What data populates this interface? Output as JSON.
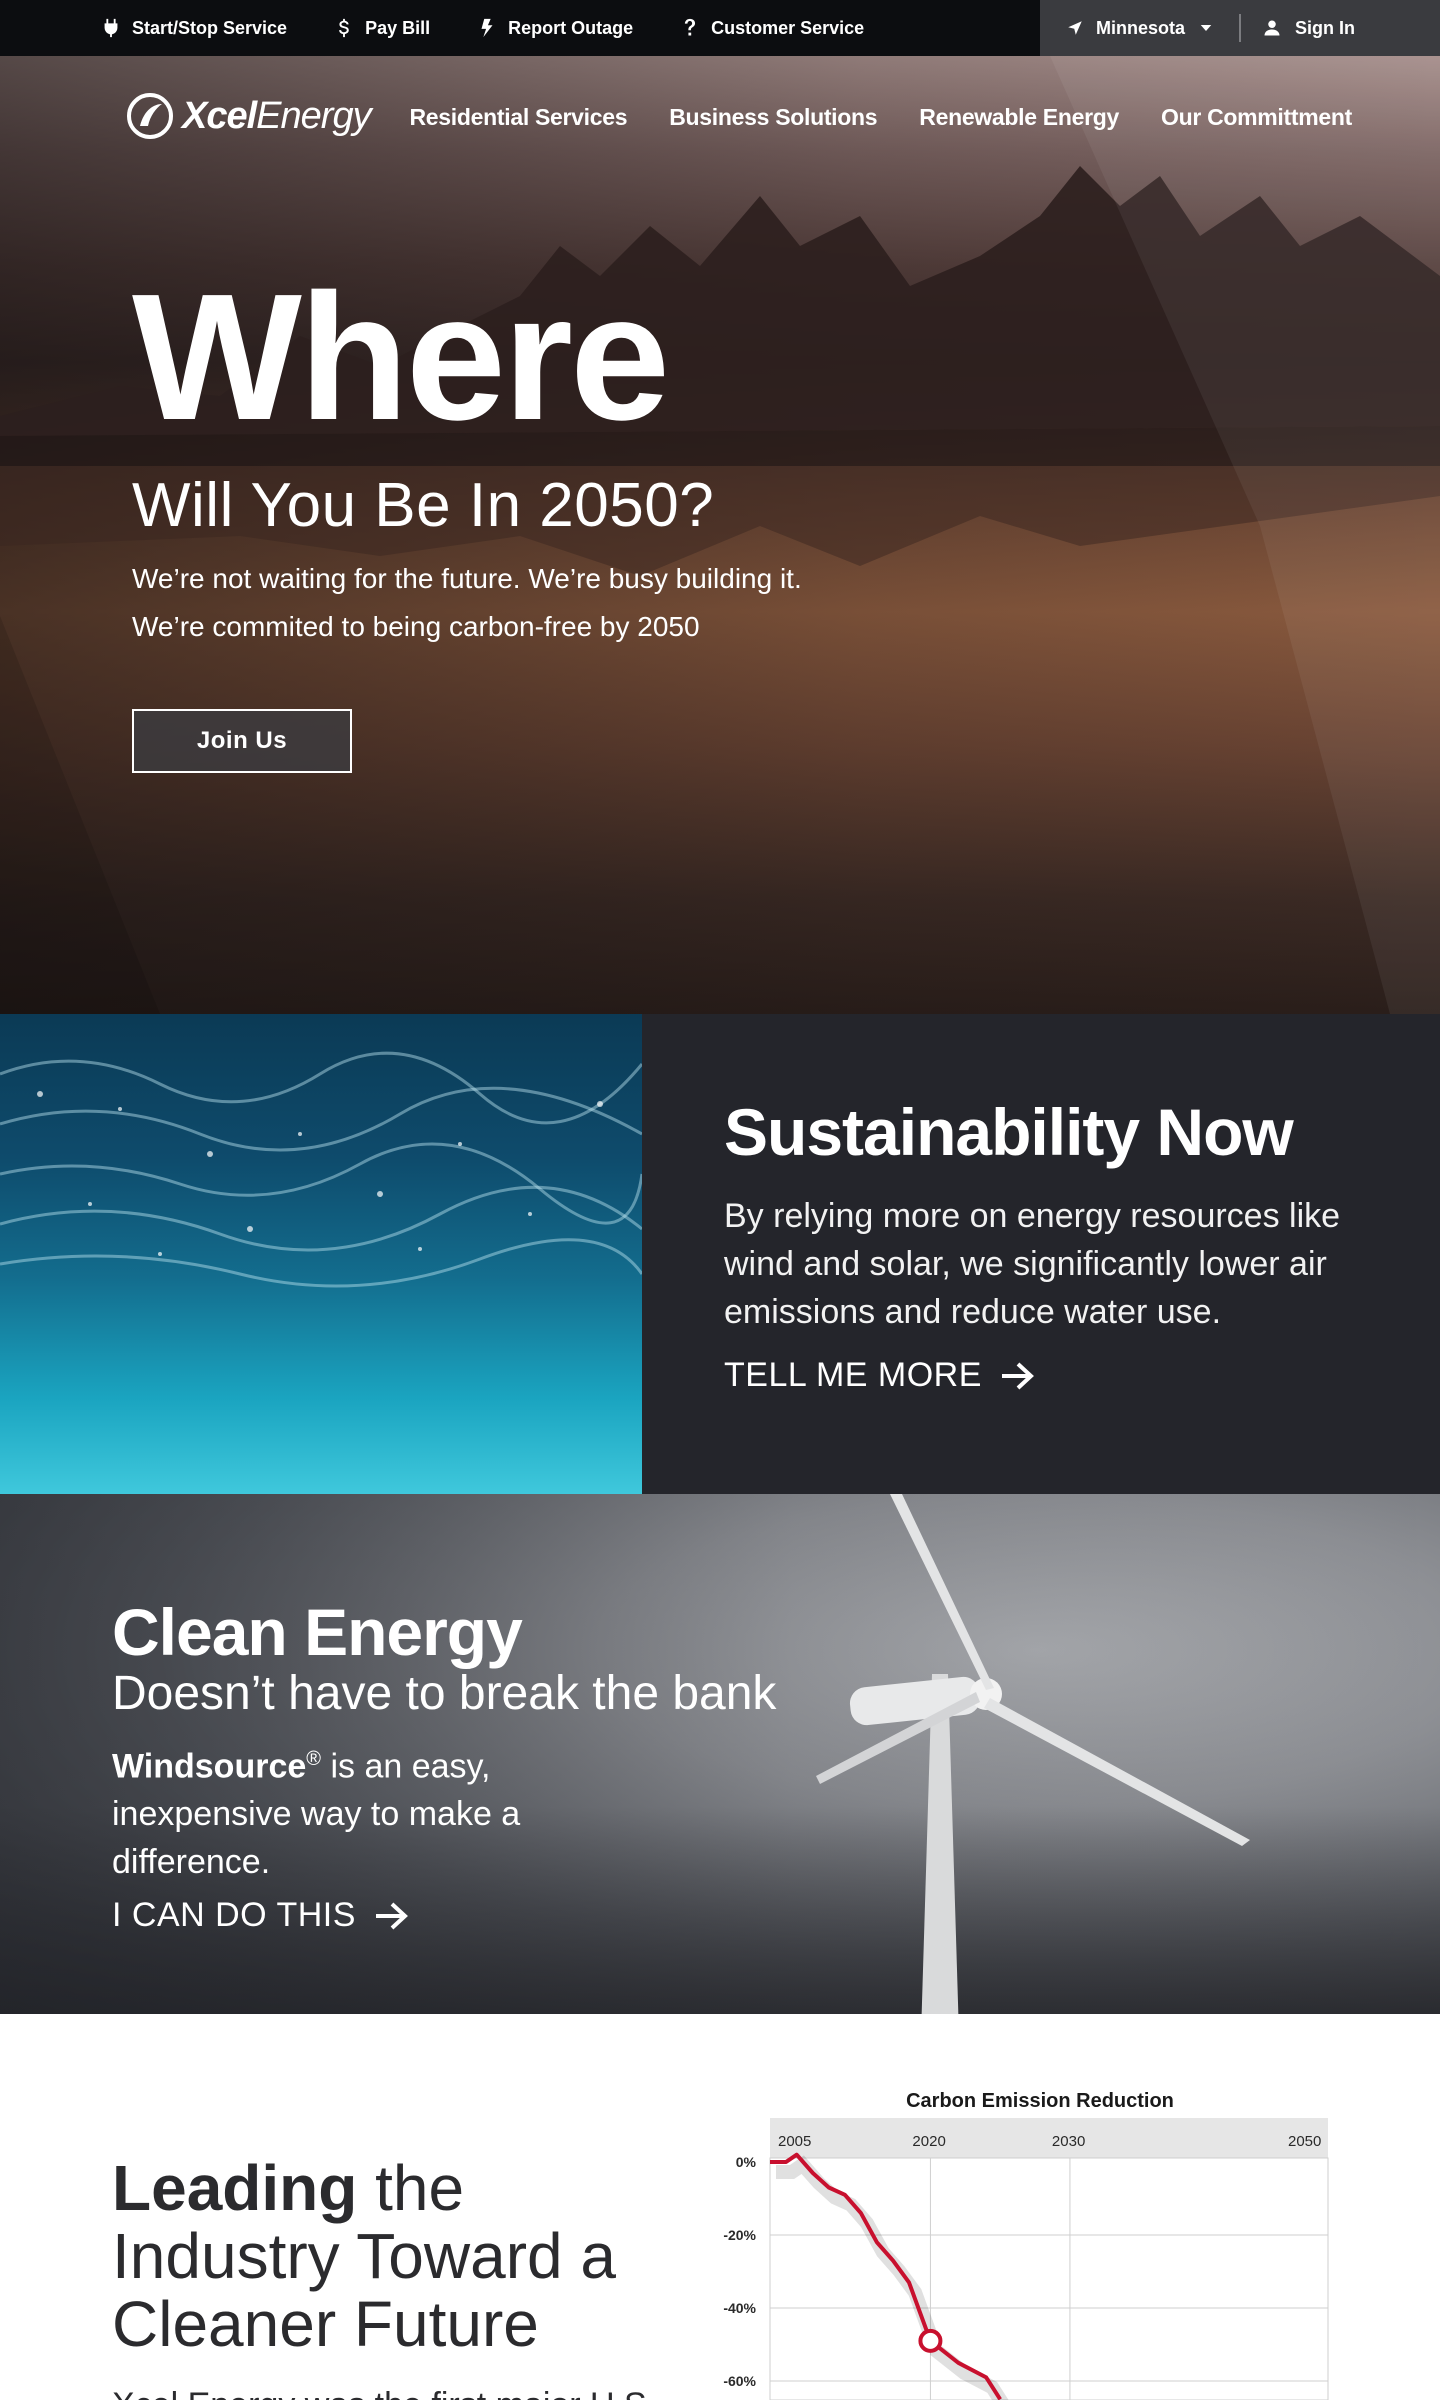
{
  "utility": {
    "links": [
      {
        "label": "Start/Stop Service",
        "icon": "plug-icon"
      },
      {
        "label": "Pay Bill",
        "icon": "dollar-icon"
      },
      {
        "label": "Report Outage",
        "icon": "lightning-icon"
      },
      {
        "label": "Customer Service",
        "icon": "question-icon"
      }
    ],
    "location": "Minnesota",
    "sign_in": "Sign In"
  },
  "header": {
    "logo_bold": "Xcel",
    "logo_light": "Energy",
    "nav": [
      "Residential Services",
      "Business Solutions",
      "Renewable Energy",
      "Our Committment"
    ]
  },
  "hero": {
    "big": "Where",
    "sub": "Will You Be In 2050?",
    "line1": "We’re not waiting for the future. We’re busy building it.",
    "line2": "We’re commited to being carbon-free by 2050",
    "button": "Join Us"
  },
  "sustainability": {
    "title": "Sustainability Now",
    "body": "By relying more on energy resources like wind and solar, we significantly lower air emissions and reduce water use.",
    "cta": "TELL ME MORE"
  },
  "clean_energy": {
    "title": "Clean Energy",
    "subtitle": "Doesn’t have to break the bank",
    "brand": "Windsource",
    "brand_mark": "®",
    "body": " is an easy, inexpensive way to make a difference.",
    "cta": "I CAN DO THIS"
  },
  "leading": {
    "title_bold": "Leading",
    "title_rest": " the",
    "title_line2": "Industry Toward a",
    "title_line3": "Cleaner Future",
    "body_partial": "Xcel Energy was the first major U.S."
  },
  "colors": {
    "accent_red": "#c8102e",
    "dark_panel": "#24252b",
    "topbar": "#0c0d10"
  },
  "chart_data": {
    "type": "line",
    "title": "Carbon Emission Reduction",
    "x_ticks": [
      "2005",
      "2020",
      "2030",
      "2050"
    ],
    "y_ticks": [
      "0%",
      "-20%",
      "-40%",
      "-60%"
    ],
    "ylim": [
      -65,
      0
    ],
    "series": [
      {
        "points": [
          [
            2005,
            0
          ],
          [
            2006.5,
            0
          ],
          [
            2007.5,
            2
          ],
          [
            2009,
            -3
          ],
          [
            2010.5,
            -7
          ],
          [
            2012,
            -9
          ],
          [
            2013.5,
            -14
          ],
          [
            2015,
            -22
          ],
          [
            2016.5,
            -27
          ],
          [
            2018,
            -33
          ],
          [
            2019,
            -41
          ],
          [
            2020,
            -49
          ],
          [
            2022,
            -55
          ],
          [
            2024,
            -59
          ],
          [
            2025,
            -65
          ]
        ],
        "marker": {
          "x": 2020,
          "y": -49
        }
      }
    ],
    "grid": true
  }
}
